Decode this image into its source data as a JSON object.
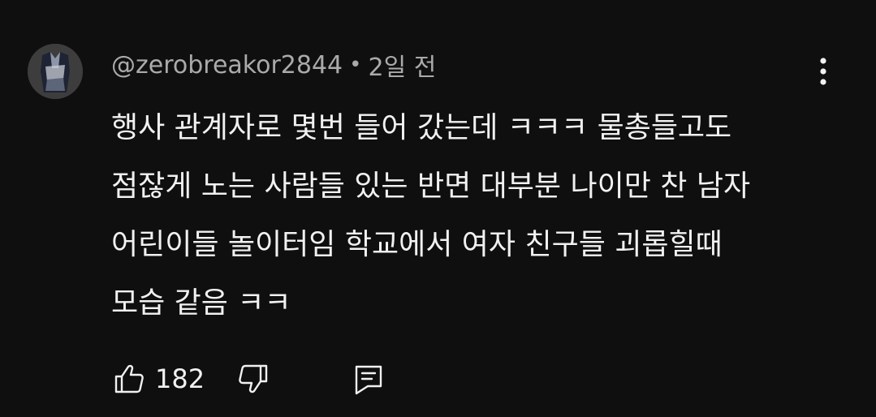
{
  "comment": {
    "author": "@zerobreakor2844",
    "separator": "•",
    "timestamp": "2일 전",
    "text_lines": [
      "행사 관계자로 몇번 들어 갔는데 ㅋㅋㅋ 물총들고도",
      "점잖게 노는 사람들 있는 반면 대부분 나이만 찬 남자",
      "어린이들 놀이터임 학교에서 여자 친구들 괴롭힐때",
      "모습 같음 ㅋㅋ"
    ],
    "like_count": "182"
  },
  "icons": {
    "avatar": "user-avatar",
    "more": "more-vert-icon",
    "like": "thumb-up-icon",
    "dislike": "thumb-down-icon",
    "reply": "reply-comment-icon"
  },
  "colors": {
    "background": "#0f0f0f",
    "primary_text": "#f1f1f1",
    "secondary_text": "#aaaaaa"
  }
}
